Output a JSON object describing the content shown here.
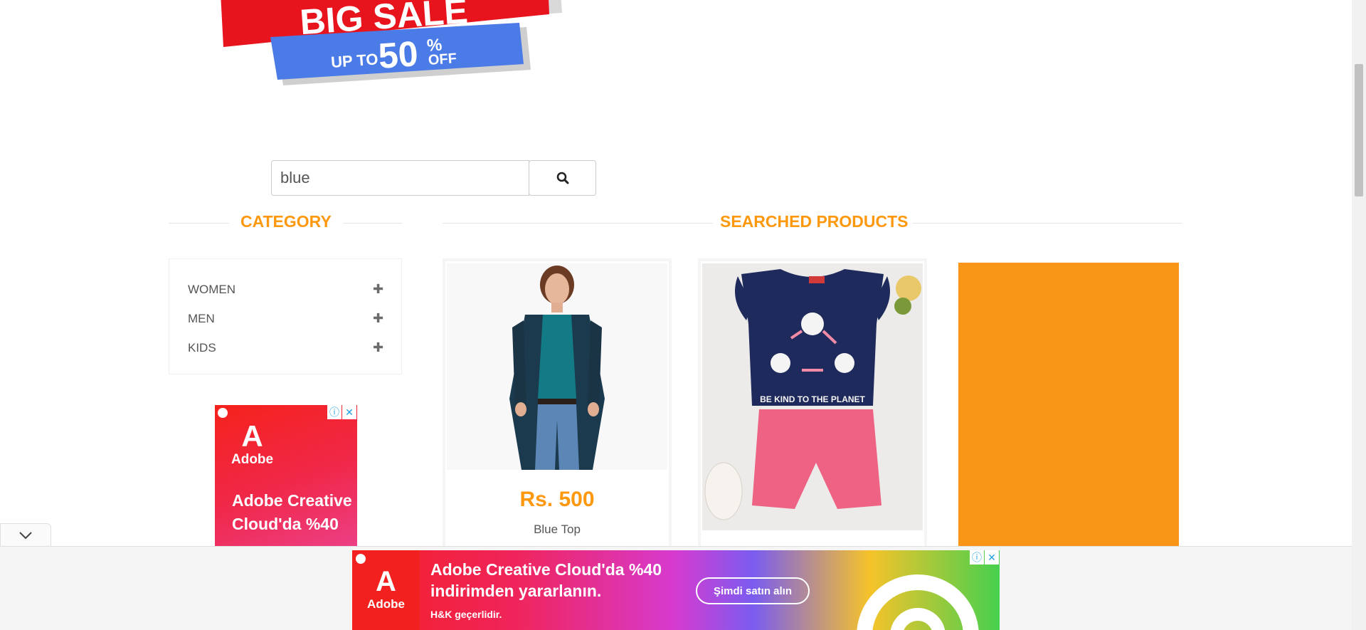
{
  "banner": {
    "headline": "BIG SALE",
    "up_to": "UP TO",
    "percent": "50",
    "percent_sign": "%",
    "off": "OFF"
  },
  "search": {
    "value": "blue",
    "icon": "search-icon"
  },
  "category": {
    "title": "CATEGORY",
    "items": [
      {
        "label": "WOMEN",
        "icon": "plus-icon"
      },
      {
        "label": "MEN",
        "icon": "plus-icon"
      },
      {
        "label": "KIDS",
        "icon": "plus-icon"
      }
    ]
  },
  "products": {
    "title": "SEARCHED PRODUCTS",
    "items": [
      {
        "price": "Rs. 500",
        "name": "Blue Top"
      }
    ]
  },
  "side_ad": {
    "brand": "Adobe",
    "text": "Adobe Creative Cloud'da %40"
  },
  "bottom_ad": {
    "brand": "Adobe",
    "title": "Adobe Creative Cloud'da %40 indirimden yararlanın.",
    "sub": "H&K geçerlidir.",
    "cta": "Şimdi satın alın"
  },
  "colors": {
    "accent": "#fe980f",
    "banner_red": "#e8141d",
    "banner_blue": "#4a7be6",
    "banner_cyan": "#23c4e8"
  }
}
